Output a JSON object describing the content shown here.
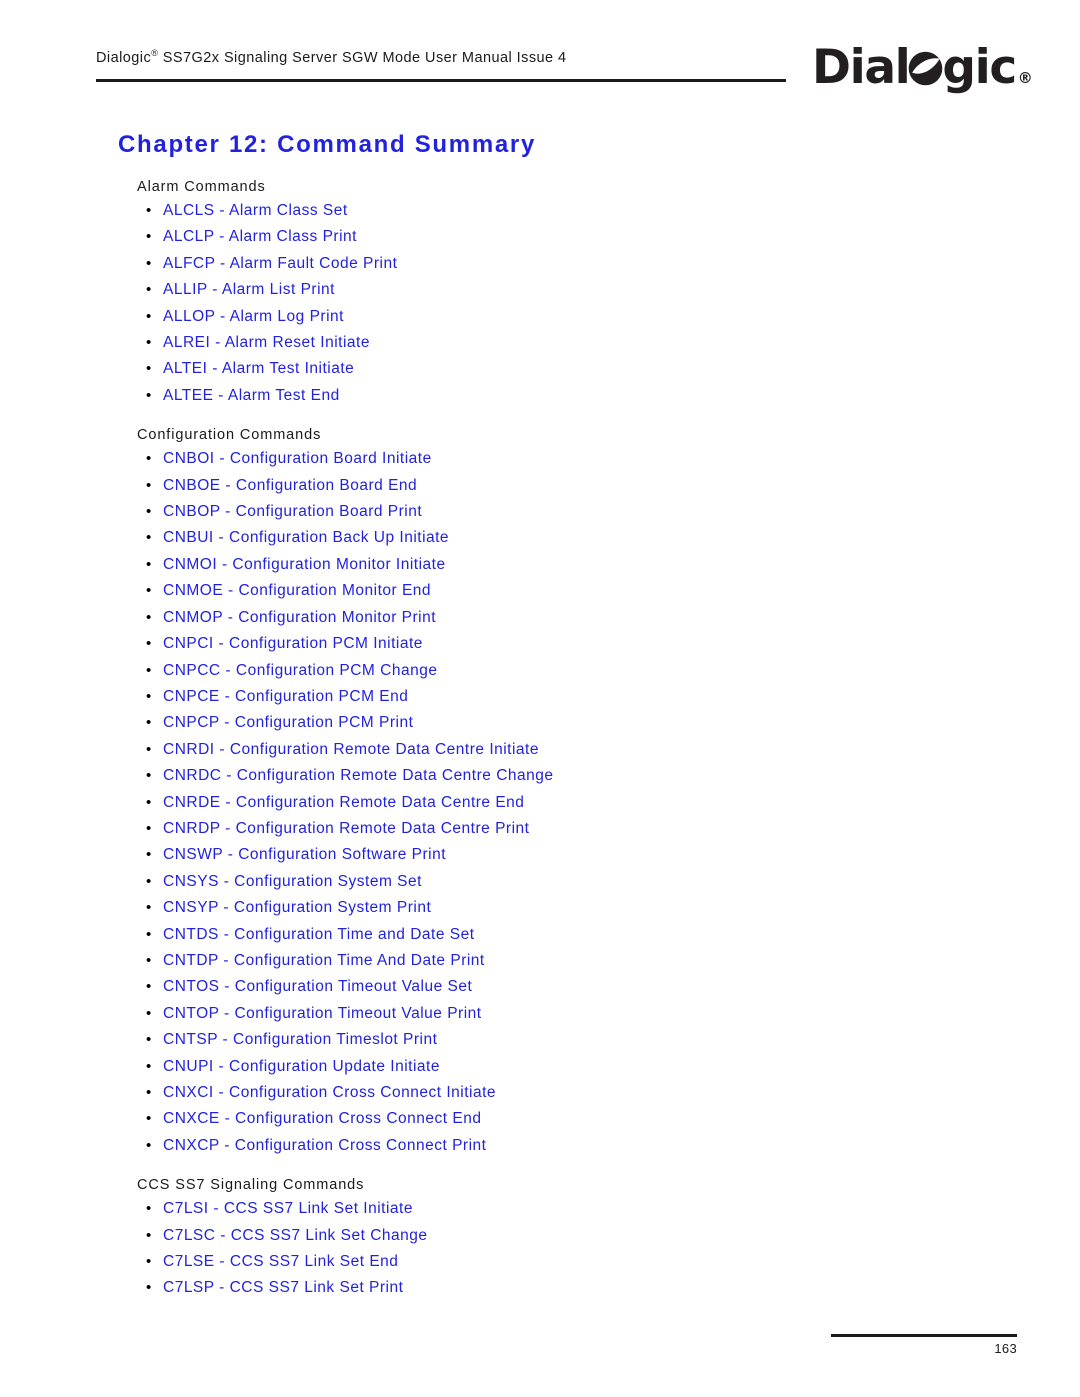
{
  "header": {
    "manual_prefix": "Dialogic",
    "registered_mark": "®",
    "manual_title": " SS7G2x Signaling Server SGW Mode User Manual  Issue 4"
  },
  "logo": {
    "part1": "Dial",
    "icon": "dialogic-o-logo-icon",
    "part2": "gic",
    "registered": "®"
  },
  "chapter": {
    "title": "Chapter 12: Command Summary"
  },
  "sections": [
    {
      "heading": "Alarm Commands",
      "items": [
        "ALCLS - Alarm Class Set",
        "ALCLP - Alarm Class Print",
        "ALFCP - Alarm Fault Code Print",
        "ALLIP - Alarm List Print",
        "ALLOP - Alarm Log Print",
        "ALREI - Alarm Reset Initiate",
        "ALTEI - Alarm Test Initiate",
        "ALTEE - Alarm Test End"
      ]
    },
    {
      "heading": "Configuration Commands",
      "items": [
        "CNBOI - Configuration Board Initiate",
        "CNBOE - Configuration Board End",
        "CNBOP - Configuration Board Print",
        "CNBUI - Configuration Back Up Initiate",
        "CNMOI - Configuration Monitor Initiate",
        "CNMOE - Configuration Monitor End",
        "CNMOP - Configuration Monitor Print",
        "CNPCI - Configuration PCM Initiate",
        "CNPCC - Configuration PCM Change",
        "CNPCE - Configuration PCM End",
        "CNPCP - Configuration PCM Print",
        "CNRDI - Configuration Remote Data Centre Initiate",
        "CNRDC - Configuration Remote Data Centre Change",
        "CNRDE - Configuration Remote Data Centre End",
        "CNRDP - Configuration Remote Data Centre Print",
        "CNSWP - Configuration Software Print",
        "CNSYS - Configuration System Set",
        "CNSYP - Configuration System Print",
        "CNTDS - Configuration Time and Date Set",
        "CNTDP - Configuration Time And Date Print",
        "CNTOS - Configuration Timeout Value Set",
        "CNTOP - Configuration Timeout Value Print",
        "CNTSP - Configuration Timeslot Print",
        "CNUPI - Configuration Update Initiate",
        "CNXCI - Configuration Cross Connect Initiate",
        "CNXCE - Configuration Cross Connect End",
        "CNXCP - Configuration Cross Connect Print"
      ]
    },
    {
      "heading": "CCS SS7 Signaling Commands",
      "items": [
        "C7LSI - CCS SS7 Link Set Initiate",
        "C7LSC - CCS SS7 Link Set Change",
        "C7LSE - CCS SS7 Link Set End",
        "C7LSP - CCS SS7 Link Set Print"
      ]
    }
  ],
  "footer": {
    "page_number": "163"
  },
  "colors": {
    "link_blue": "#2222dd",
    "text_black": "#1a1a1a",
    "logo_black": "#231f20"
  },
  "bullet_glyph": "•"
}
